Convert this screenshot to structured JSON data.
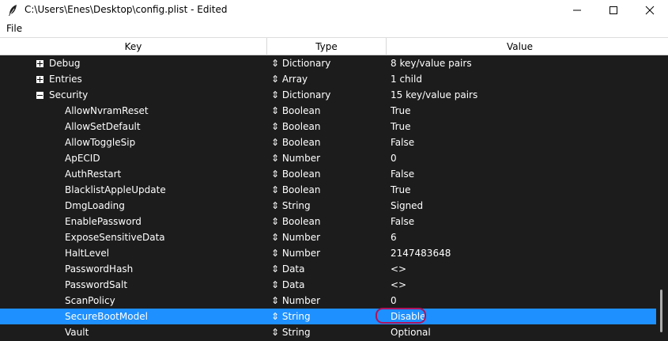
{
  "window": {
    "title": "C:\\Users\\Enes\\Desktop\\config.plist - Edited",
    "icon": "feather-icon"
  },
  "menu": {
    "file_label": "File"
  },
  "columns": {
    "key": "Key",
    "type": "Type",
    "value": "Value"
  },
  "type_icon": "updown-arrow-icon",
  "rows": [
    {
      "key": "Debug",
      "type": "Dictionary",
      "value": "8 key/value pairs",
      "expander": "plus"
    },
    {
      "key": "Entries",
      "type": "Array",
      "value": "1 child",
      "expander": "plus"
    },
    {
      "key": "Security",
      "type": "Dictionary",
      "value": "15 key/value pairs",
      "expander": "minus"
    },
    {
      "key": "AllowNvramReset",
      "type": "Boolean",
      "value": "True"
    },
    {
      "key": "AllowSetDefault",
      "type": "Boolean",
      "value": "True"
    },
    {
      "key": "AllowToggleSip",
      "type": "Boolean",
      "value": "False"
    },
    {
      "key": "ApECID",
      "type": "Number",
      "value": "0"
    },
    {
      "key": "AuthRestart",
      "type": "Boolean",
      "value": "False"
    },
    {
      "key": "BlacklistAppleUpdate",
      "type": "Boolean",
      "value": "True"
    },
    {
      "key": "DmgLoading",
      "type": "String",
      "value": "Signed"
    },
    {
      "key": "EnablePassword",
      "type": "Boolean",
      "value": "False"
    },
    {
      "key": "ExposeSensitiveData",
      "type": "Number",
      "value": "6"
    },
    {
      "key": "HaltLevel",
      "type": "Number",
      "value": "2147483648"
    },
    {
      "key": "PasswordHash",
      "type": "Data",
      "value": "<>"
    },
    {
      "key": "PasswordSalt",
      "type": "Data",
      "value": "<>"
    },
    {
      "key": "ScanPolicy",
      "type": "Number",
      "value": "0"
    },
    {
      "key": "SecureBootModel",
      "type": "String",
      "value": "Disable",
      "selected": true
    },
    {
      "key": "Vault",
      "type": "String",
      "value": "Optional"
    }
  ],
  "colors": {
    "tree_background": "#1c1c1c",
    "selection": "#1e90ff",
    "annotation_ring": "#b0125a"
  }
}
